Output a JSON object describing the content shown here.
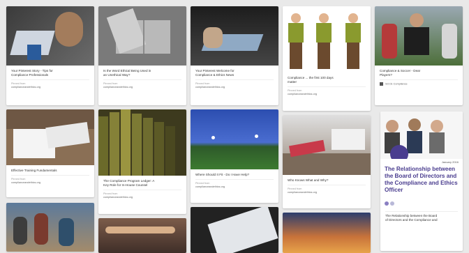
{
  "pins": [
    {
      "title": "Your Pinterest Story - Tips for\nCompliance Professionals",
      "source_label": "Pinned from",
      "domain": "complianceandethics.org"
    },
    {
      "title": "Is the Word Ethical Being Used in\nan Unethical Way?",
      "source_label": "Pinned from",
      "domain": "complianceandethics.org"
    },
    {
      "title": "Your Pinterest Welcome for\nCompliance & Ethics News",
      "source_label": "Pinned from",
      "domain": "complianceandethics.org"
    },
    {
      "title": "Compliance ... the first 100 days\nmatter",
      "source_label": "Pinned from",
      "domain": "complianceandethics.org"
    },
    {
      "title": "Compliance & Soccer - Dear\nPlayers?",
      "source_label": "",
      "domain": "SCCE Compliance"
    },
    {
      "title": "Effective Training Fundamentals",
      "source_label": "Pinned from",
      "domain": "complianceandethics.org"
    },
    {
      "title": "The Compliance Program Ledger: A\nKey Role for In-House Counsel",
      "source_label": "Pinned from",
      "domain": "complianceandethics.org"
    },
    {
      "title": "Where Should It Fit - Do I Have Help?",
      "source_label": "Pinned from",
      "domain": "complianceandethics.org"
    },
    {
      "title": "Who Knows What and Why?",
      "source_label": "Pinned from",
      "domain": "complianceandethics.org"
    },
    {
      "title": "The Relationship between the Board\nof Directors and the Compliance and",
      "source_label": "",
      "domain": ""
    }
  ],
  "featured": {
    "heading": "The Relationship between the Board of Directors and the Compliance and Ethics Officer",
    "date": "January 2016"
  },
  "colors": {
    "background": "#e9e9e9",
    "card": "#ffffff",
    "featured_purple": "#4a3d8f"
  }
}
